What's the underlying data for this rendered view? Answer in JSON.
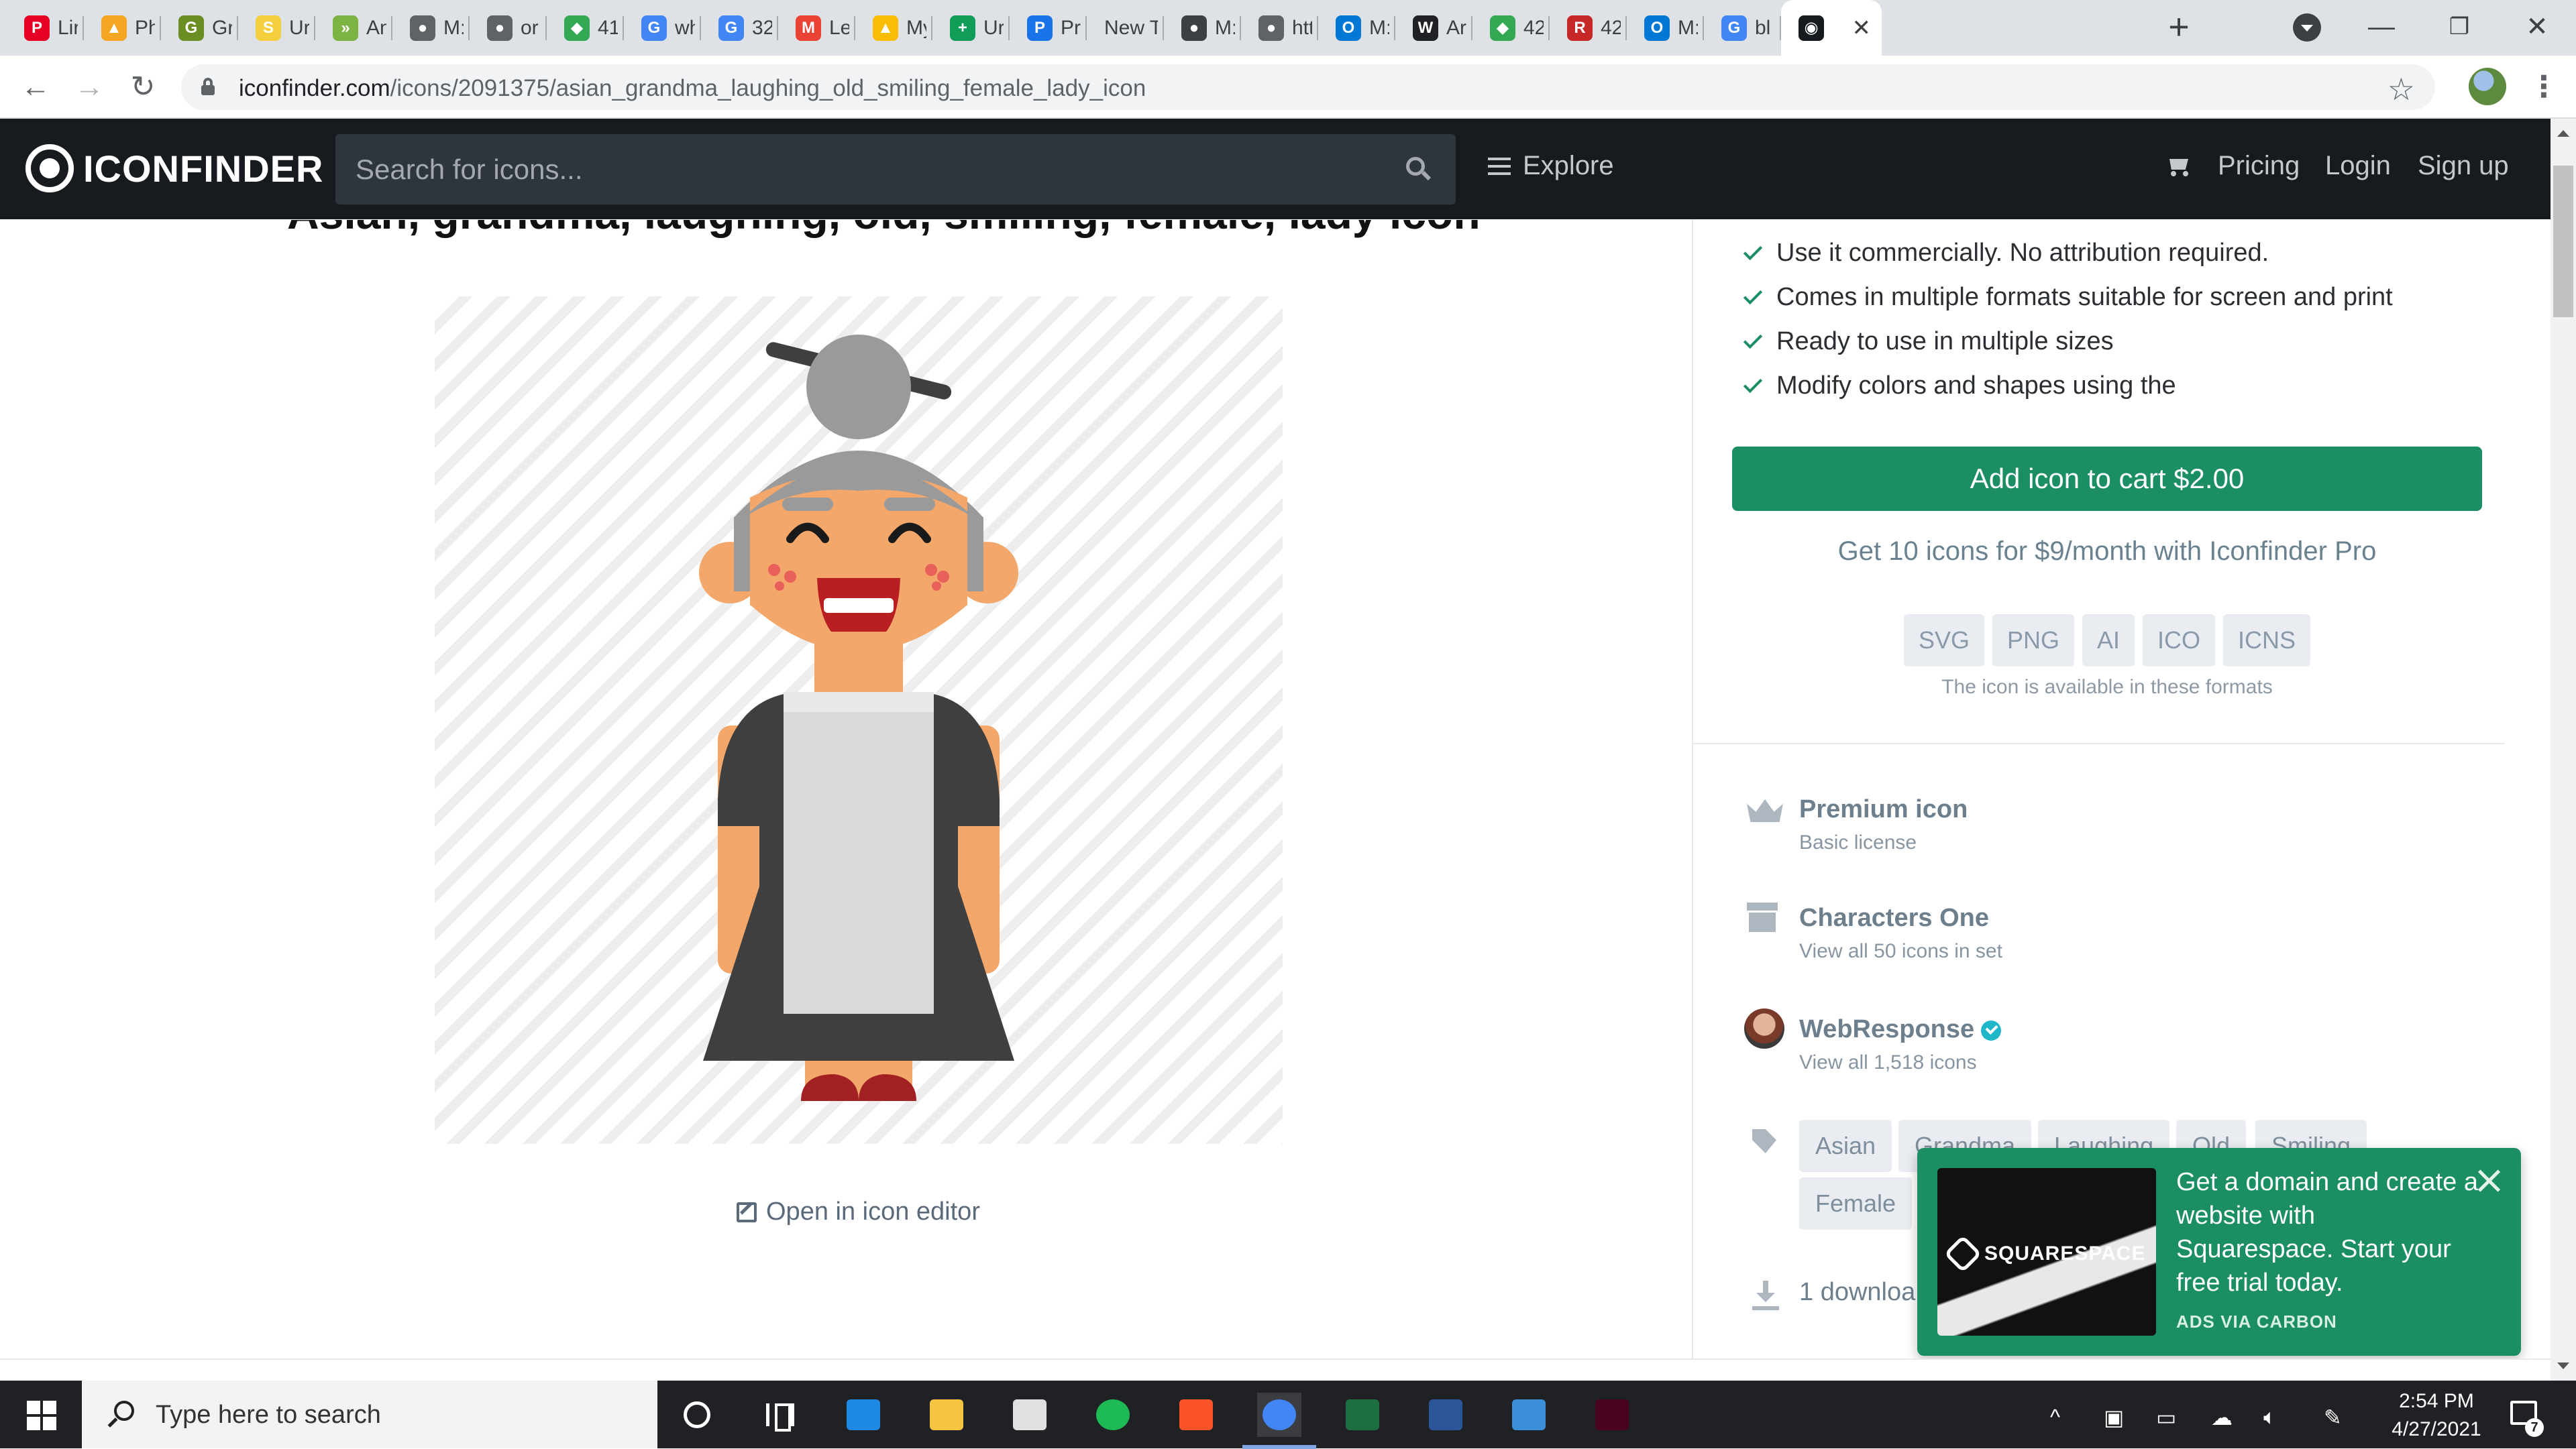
{
  "browser": {
    "tabs": [
      {
        "title": "Lir",
        "icon": "pinterest-icon",
        "color": "#e60023",
        "glyph": "P"
      },
      {
        "title": "Ph",
        "icon": "ph-icon",
        "color": "#f5a623",
        "glyph": "▲"
      },
      {
        "title": "Gr",
        "icon": "philageo-icon",
        "color": "#6b8e23",
        "glyph": "G"
      },
      {
        "title": "Ur",
        "icon": "step-icon",
        "color": "#f4d03f",
        "glyph": "S"
      },
      {
        "title": "An",
        "icon": "arrow-icon",
        "color": "#7cb342",
        "glyph": "»"
      },
      {
        "title": "M:",
        "icon": "globe-icon",
        "color": "#5f6368",
        "glyph": "●"
      },
      {
        "title": "or",
        "icon": "globe-icon",
        "color": "#5f6368",
        "glyph": "●"
      },
      {
        "title": "41",
        "icon": "maps-icon",
        "color": "#34a853",
        "glyph": "◆"
      },
      {
        "title": "wh",
        "icon": "google-icon",
        "color": "#4285f4",
        "glyph": "G"
      },
      {
        "title": "32",
        "icon": "google-icon",
        "color": "#4285f4",
        "glyph": "G"
      },
      {
        "title": "Le",
        "icon": "gmail-icon",
        "color": "#ea4335",
        "glyph": "M"
      },
      {
        "title": "My",
        "icon": "drive-icon",
        "color": "#fbbc04",
        "glyph": "▲"
      },
      {
        "title": "Ur",
        "icon": "sheets-plus-icon",
        "color": "#0f9d58",
        "glyph": "+"
      },
      {
        "title": "Pr",
        "icon": "pr-icon",
        "color": "#1a73e8",
        "glyph": "P"
      },
      {
        "title": "New Ta",
        "icon": "",
        "color": "",
        "glyph": ""
      },
      {
        "title": "M:",
        "icon": "robot-icon",
        "color": "#3c4043",
        "glyph": "●"
      },
      {
        "title": "htt",
        "icon": "globe-icon",
        "color": "#5f6368",
        "glyph": "●"
      },
      {
        "title": "M:",
        "icon": "outlook-icon",
        "color": "#0078d4",
        "glyph": "O"
      },
      {
        "title": "Ar",
        "icon": "wikipedia-icon",
        "color": "#202124",
        "glyph": "W"
      },
      {
        "title": "42",
        "icon": "maps-icon",
        "color": "#34a853",
        "glyph": "◆"
      },
      {
        "title": "42",
        "icon": "r-icon",
        "color": "#c62828",
        "glyph": "R"
      },
      {
        "title": "M:",
        "icon": "outlook-icon",
        "color": "#0078d4",
        "glyph": "O"
      },
      {
        "title": "bl",
        "icon": "google-icon",
        "color": "#4285f4",
        "glyph": "G"
      },
      {
        "title": "",
        "icon": "iconfinder-icon",
        "color": "#171b20",
        "glyph": "◉",
        "active": true
      }
    ],
    "url_host": "iconfinder.com",
    "url_path": "/icons/2091375/asian_grandma_laughing_old_smiling_female_lady_icon"
  },
  "header": {
    "logo": "ICONFINDER",
    "search_placeholder": "Search for icons...",
    "explore": "Explore",
    "pricing": "Pricing",
    "login": "Login",
    "signup": "Sign up"
  },
  "main": {
    "title": "Asian, grandma, laughing, old, smiling, female, lady icon",
    "open_editor": "Open in icon editor"
  },
  "panel": {
    "features": [
      "Use it commercially. No attribution required.",
      "Comes in multiple formats suitable for screen and print",
      "Ready to use in multiple sizes",
      "Modify colors and shapes using the"
    ],
    "add_to_cart": "Add icon to cart $2.00",
    "pro_offer": "Get 10 icons for $9/month with Iconfinder Pro",
    "formats": [
      "SVG",
      "PNG",
      "AI",
      "ICO",
      "ICNS"
    ],
    "formats_note": "The icon is available in these formats",
    "license_title": "Premium icon",
    "license_sub": "Basic license",
    "set_title": "Characters One",
    "set_sub": "View all 50 icons in set",
    "author_title": "WebResponse",
    "author_sub": "View all 1,518 icons",
    "tags": [
      "Asian",
      "Grandma",
      "Laughing",
      "Old",
      "Smiling",
      "Female"
    ],
    "downloads": "1 downloa"
  },
  "ad": {
    "brand": "SQUARESPACE",
    "text": "Get a domain and create a website with Squarespace. Start your free trial today.",
    "via": "ADS VIA CARBON"
  },
  "taskbar": {
    "search_placeholder": "Type here to search",
    "apps": [
      {
        "name": "cortana-icon"
      },
      {
        "name": "task-view-icon"
      },
      {
        "name": "mail-icon",
        "color": "#1e88e5"
      },
      {
        "name": "file-explorer-icon",
        "color": "#f6c343"
      },
      {
        "name": "store-icon",
        "color": "#e0e0e0"
      },
      {
        "name": "spotify-icon",
        "color": "#1db954"
      },
      {
        "name": "brave-icon",
        "color": "#fb542b"
      },
      {
        "name": "chrome-icon",
        "color": "#4285f4"
      },
      {
        "name": "excel-icon",
        "color": "#1d6f42"
      },
      {
        "name": "word-icon",
        "color": "#2b579a"
      },
      {
        "name": "photos-icon",
        "color": "#3a8fd8"
      },
      {
        "name": "indesign-icon",
        "color": "#49021f"
      }
    ],
    "time": "2:54 PM",
    "date": "4/27/2021",
    "notification_count": "7"
  }
}
